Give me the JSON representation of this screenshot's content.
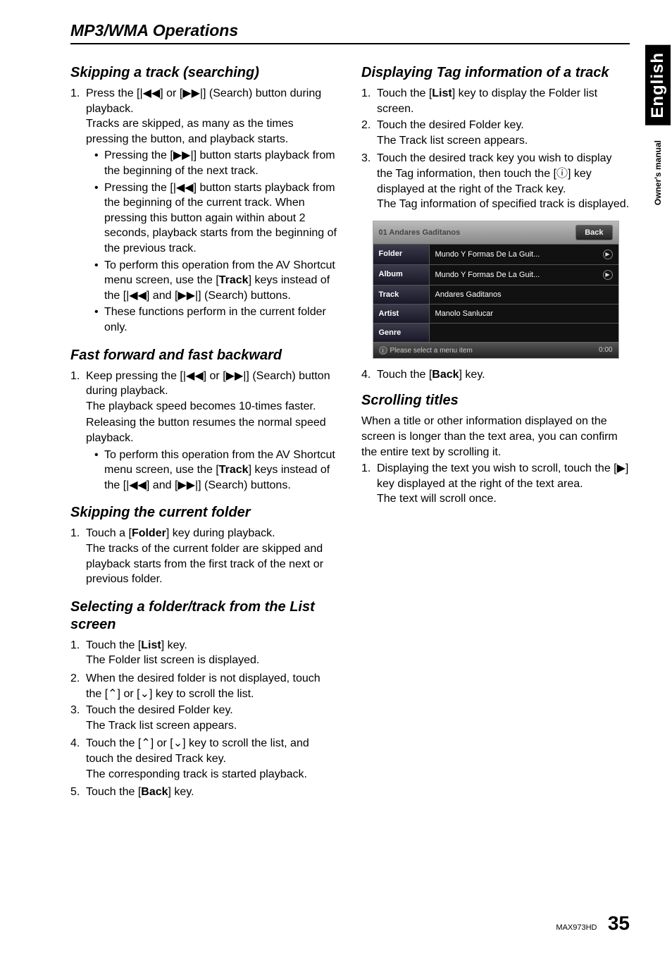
{
  "page": {
    "section_title": "MP3/WMA Operations",
    "footer_model": "MAX973HD",
    "footer_page": "35",
    "side_tabs": {
      "lang": "English",
      "manual": "Owner's manual"
    }
  },
  "icons": {
    "prev": "|◀◀",
    "next": "▶▶|",
    "up": "⌃",
    "down": "⌄",
    "info": "ⓘ",
    "scroll": "▶"
  },
  "left": {
    "h1": "Skipping a track (searching)",
    "s1_num": "1.",
    "s1_a": "Press the [",
    "s1_b": "] or [",
    "s1_c": "] (Search) button during playback.",
    "s1_p2": "Tracks are skipped, as many as the times pressing the button, and playback starts.",
    "b1a": "Pressing the [",
    "b1b": "] button starts playback from the beginning of the next track.",
    "b2a": "Pressing the [",
    "b2b": "] button starts playback from the beginning of the current track. When pressing this button again within about 2 seconds, playback starts from the beginning of the previous track.",
    "b3a": "To perform this operation from the AV Shortcut menu screen, use the [",
    "b3key": "Track",
    "b3b": "] keys instead of the [",
    "b3c": "] and [",
    "b3d": "] (Search) buttons.",
    "b4": "These functions perform in the current folder only.",
    "h2": "Fast forward and fast backward",
    "s2_num": "1.",
    "s2_a": "Keep pressing the [",
    "s2_b": "] or [",
    "s2_c": "] (Search) button during playback.",
    "s2_p2": "The playback speed becomes 10-times faster.",
    "s2_p3": "Releasing the button resumes the normal speed playback.",
    "b5a": "To perform this operation from the AV Shortcut menu screen, use the [",
    "b5key": "Track",
    "b5b": "] keys instead of the [",
    "b5c": "] and [",
    "b5d": "] (Search) buttons.",
    "h3": "Skipping the current folder",
    "s3_num": "1.",
    "s3_a": "Touch a [",
    "s3_key": "Folder",
    "s3_b": "] key during playback.",
    "s3_p2": "The tracks of the current folder are skipped and playback starts from the first track of the next or previous folder.",
    "h4": "Selecting a folder/track from the List screen",
    "s4_1_num": "1.",
    "s4_1_a": "Touch the [",
    "s4_1_key": "List",
    "s4_1_b": "] key.",
    "s4_1_p2": "The Folder list screen is displayed.",
    "s4_2_num": "2.",
    "s4_2_a": "When the desired folder is not displayed, touch the [",
    "s4_2_b": "] or [",
    "s4_2_c": "] key to scroll the list.",
    "s4_3_num": "3.",
    "s4_3_a": "Touch the desired Folder key.",
    "s4_3_p2": "The Track list screen appears.",
    "s4_4_num": "4.",
    "s4_4_a": "Touch the [",
    "s4_4_b": "] or [",
    "s4_4_c": "] key to scroll the list, and touch the desired Track key.",
    "s4_4_p2": "The corresponding track is started playback.",
    "s4_5_num": "5.",
    "s4_5_a": "Touch the [",
    "s4_5_key": "Back",
    "s4_5_b": "] key."
  },
  "right": {
    "h1": "Displaying Tag information of a track",
    "s1_num": "1.",
    "s1_a": "Touch the [",
    "s1_key": "List",
    "s1_b": "] key to display the Folder list screen.",
    "s2_num": "2.",
    "s2_a": "Touch the desired Folder key.",
    "s2_p2": "The Track list screen appears.",
    "s3_num": "3.",
    "s3_a": "Touch the desired track key you wish to display the Tag information, then touch the [",
    "s3_b": "] key displayed at the right of the Track key.",
    "s3_p2": "The Tag information of specified track is displayed.",
    "s4_num": "4.",
    "s4_a": "Touch the [",
    "s4_key": "Back",
    "s4_b": "] key.",
    "h2": "Scrolling titles",
    "p1": "When a title or other information displayed on the screen is longer than the text area, you can confirm the entire text by scrolling it.",
    "s5_num": "1.",
    "s5_a": "Displaying the text you wish to scroll, touch the [",
    "s5_b": "] key displayed at the right of the text area.",
    "s5_p2": "The text will scroll once."
  },
  "tag_ui": {
    "title": "01 Andares Gaditanos",
    "back": "Back",
    "rows": [
      {
        "label": "Folder",
        "value": "Mundo Y Formas De La Guit...",
        "scroll": true
      },
      {
        "label": "Album",
        "value": "Mundo Y Formas De La Guit...",
        "scroll": true
      },
      {
        "label": "Track",
        "value": "Andares Gaditanos",
        "scroll": false
      },
      {
        "label": "Artist",
        "value": "Manolo Sanlucar",
        "scroll": false
      },
      {
        "label": "Genre",
        "value": "",
        "scroll": false
      }
    ],
    "footer_text": "Please select a menu item",
    "footer_time": "0:00"
  }
}
